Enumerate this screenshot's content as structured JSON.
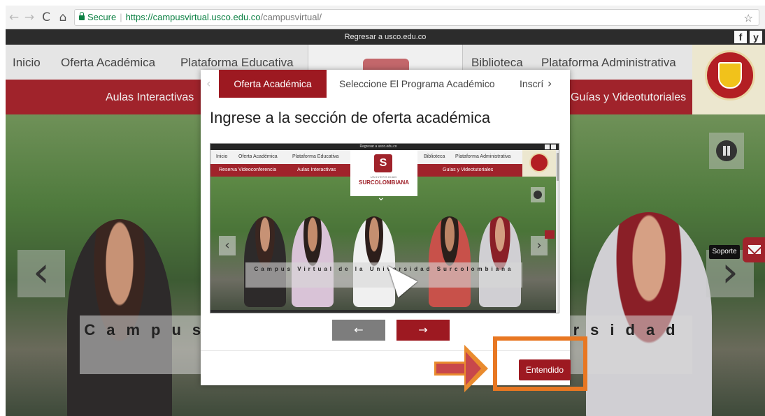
{
  "browser": {
    "back_icon": "←",
    "forward_icon": "→",
    "reload_icon": "C",
    "home_icon": "⌂",
    "secure_label": "Secure",
    "separator": "|",
    "url_host": "https://campusvirtual.usco.edu.co",
    "url_path": "/campusvirtual/",
    "star_icon": "☆"
  },
  "header": {
    "topstrip_text": "Regresar a usco.edu.co",
    "facebook_glyph": "f",
    "twitter_glyph": "y",
    "nav": [
      "Inicio",
      "Oferta Académica",
      "Plataforma Educativa",
      "Biblioteca",
      "Plataforma Administrativa"
    ],
    "subnav": [
      "Aulas Interactivas",
      "Guías y Videotutoriales"
    ]
  },
  "hero": {
    "caption": "Campus Virtual de la Universidad",
    "prev_icon": "‹",
    "next_icon": "›",
    "support_tooltip": "Soporte"
  },
  "modal": {
    "tab_prev_icon": "‹",
    "tab_next_icon": "›",
    "tabs": [
      "Oferta Académica",
      "Seleccione El Programa Académico",
      "Inscríbase"
    ],
    "title": "Ingrese a la sección de oferta académica",
    "step_prev_icon": "←",
    "step_next_icon": "→",
    "confirm_label": "Entendido"
  },
  "preview": {
    "topstrip_text": "Regresar a usco.edu.co",
    "nav": [
      "Inicio",
      "Oferta Académica",
      "Plataforma Educativa",
      "Biblioteca",
      "Plataforma Administrativa"
    ],
    "subnav": [
      "Reserva Videoconferencia",
      "Aulas Interactivas",
      "Guías y Videotutoriales"
    ],
    "logo_mark": "S",
    "logo_small": "UNIVERSIDAD",
    "logo_name": "SURCOLOMBIANA",
    "chevron_icon": "⌄",
    "prev_icon": "‹",
    "next_icon": "›",
    "caption": "Campus Virtual de la Universidad Surcolombiana"
  },
  "colors": {
    "brand_red": "#9d1921",
    "annotation_orange": "#e87722",
    "secure_green": "#0b8043"
  }
}
